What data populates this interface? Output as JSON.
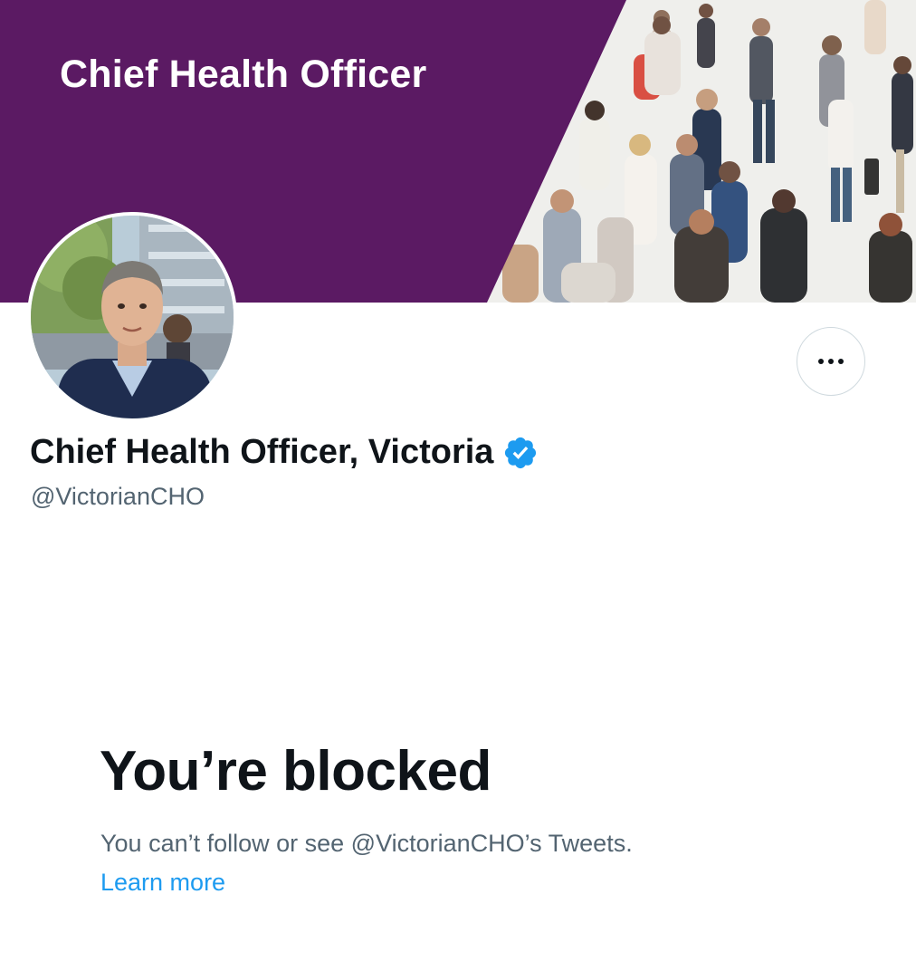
{
  "banner": {
    "title": "Chief Health Officer",
    "accent_color": "#5b1a63",
    "image": "crowd-of-pedestrians-photo"
  },
  "profile": {
    "avatar": "profile-photo-man-in-suit",
    "display_name": "Chief Health Officer, Victoria",
    "verified": true,
    "verified_color": "#1d9bf0",
    "handle": "@VictorianCHO",
    "more_icon": "ellipsis-icon"
  },
  "blocked": {
    "title": "You’re blocked",
    "description": "You can’t follow or see @VictorianCHO’s Tweets.",
    "learn_more": "Learn more",
    "link_color": "#1d9bf0"
  }
}
